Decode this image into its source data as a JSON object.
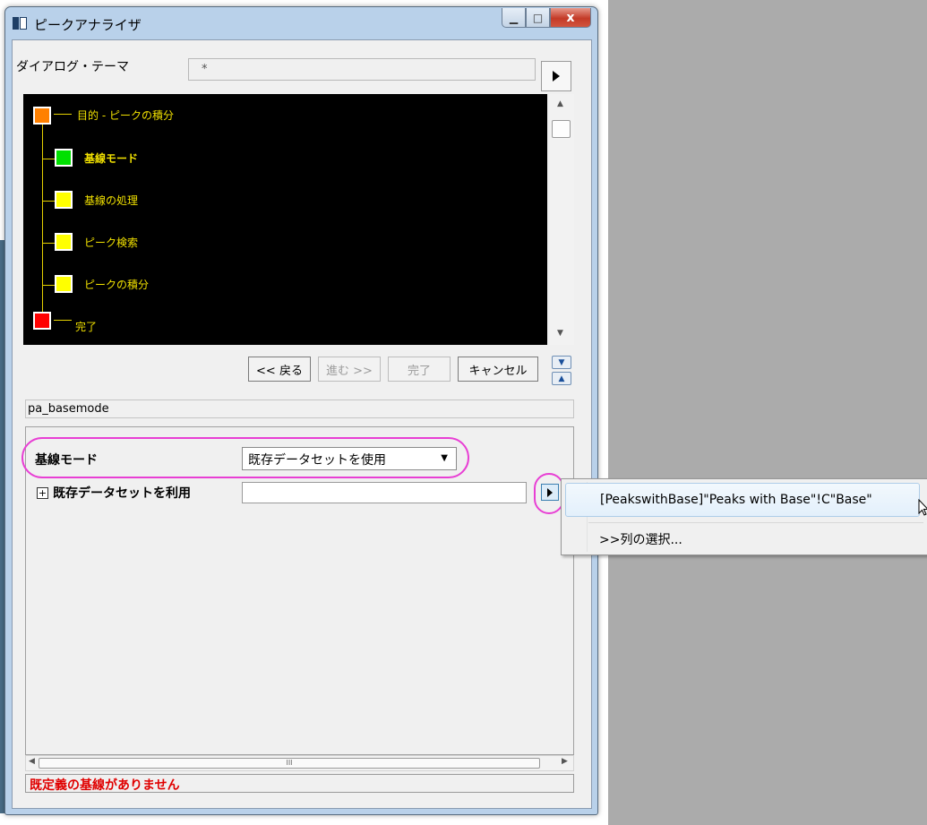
{
  "window": {
    "title": "ピークアナライザ",
    "min_glyph": "▁",
    "max_glyph": "□",
    "close_glyph": "x"
  },
  "theme": {
    "label": "ダイアログ・テーマ",
    "value": "*"
  },
  "tree": {
    "nodes": [
      {
        "label": "目的 - ピークの積分",
        "color": "#ff8000"
      },
      {
        "label": "基線モード",
        "color": "#00e000",
        "bold": true
      },
      {
        "label": "基線の処理",
        "color": "#ffff00"
      },
      {
        "label": "ピーク検索",
        "color": "#ffff00"
      },
      {
        "label": "ピークの積分",
        "color": "#ffff00"
      },
      {
        "label": "完了",
        "color": "#ff0000"
      }
    ]
  },
  "nav": {
    "back": "<< 戻る",
    "next": "進む >>",
    "finish": "完了",
    "cancel": "キャンセル"
  },
  "page_hint": "pa_basemode",
  "settings": {
    "baseline_mode_label": "基線モード",
    "baseline_mode_value": "既存データセットを使用",
    "expander_glyph": "⊞",
    "use_existing_label": "既存データセットを利用",
    "use_existing_value": ""
  },
  "status_message": "既定義の基線がありません",
  "scrollbar_grip": "III",
  "popup": {
    "item1": "[PeakswithBase]\"Peaks with Base\"!C\"Base\"",
    "item2": ">>列の選択..."
  }
}
